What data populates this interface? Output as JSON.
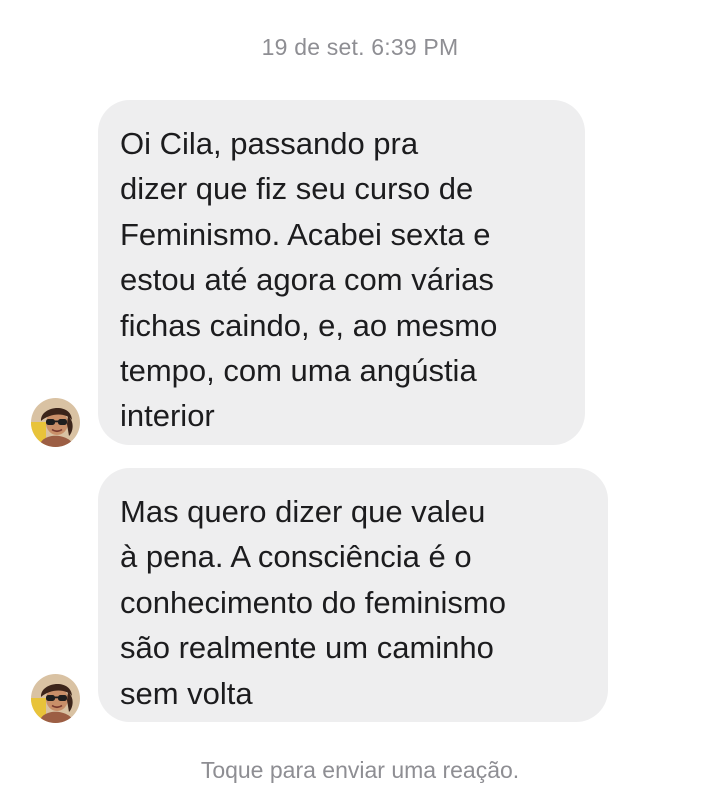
{
  "conversation": {
    "timestamp": "19 de set. 6:39 PM",
    "messages": [
      {
        "sender": "contact",
        "avatar_icon": "contact-avatar-photo",
        "lines": [
          "Oi Cila, passando pra",
          "dizer que fiz seu curso de",
          "Feminismo. Acabei sexta e",
          "estou até agora com várias",
          "fichas caindo, e, ao mesmo",
          "tempo, com uma angústia",
          "interior"
        ]
      },
      {
        "sender": "contact",
        "avatar_icon": "contact-avatar-photo",
        "lines": [
          "Mas quero dizer que valeu",
          "à pena. A consciência é o",
          "conhecimento do feminismo",
          "são realmente um caminho",
          "sem volta"
        ]
      }
    ],
    "reaction_hint": "Toque para enviar uma reação."
  },
  "colors": {
    "bubble_background": "#eeeeef",
    "message_text": "#1c1c1e",
    "meta_text": "#8e8e93",
    "page_background": "#ffffff"
  }
}
